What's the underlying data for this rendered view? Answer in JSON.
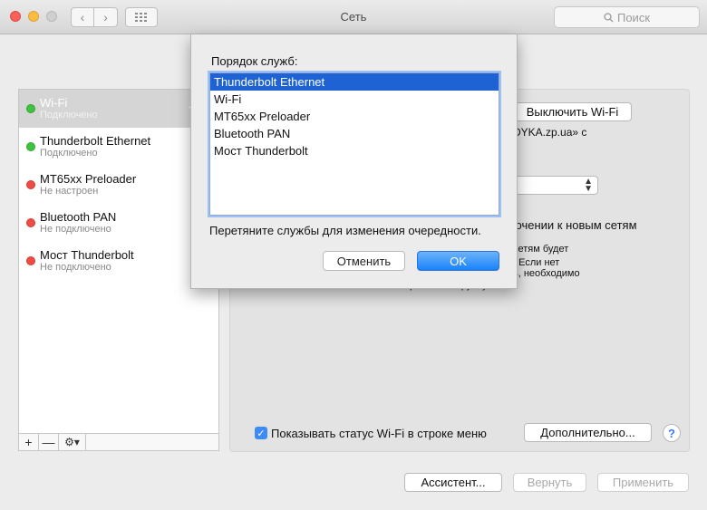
{
  "window": {
    "title": "Сеть"
  },
  "toolbar": {
    "search_placeholder": "Поиск",
    "back_glyph": "‹",
    "forward_glyph": "›"
  },
  "sidebar": {
    "items": [
      {
        "name": "Wi-Fi",
        "status": "Подключено",
        "status_color": "green",
        "selected": true,
        "icon": "wifi-icon"
      },
      {
        "name": "Thunderbolt Ethernet",
        "status": "Подключено",
        "status_color": "green",
        "icon": "ethernet-icon"
      },
      {
        "name": "MT65xx Preloader",
        "status": "Не настроен",
        "status_color": "red",
        "icon": "phone-icon"
      },
      {
        "name": "Bluetooth PAN",
        "status": "Не подключено",
        "status_color": "red",
        "icon": "bluetooth-icon"
      },
      {
        "name": "Мост Thunderbolt",
        "status": "Не подключено",
        "status_color": "red",
        "icon": "ethernet-icon"
      }
    ],
    "tools": {
      "add": "+",
      "remove": "—",
      "gear": "⚙▾"
    }
  },
  "main": {
    "wifi_off_button": "Выключить Wi-Fi",
    "network_text": "DYKA.zp.ua» с",
    "ask_join_text": "ючении к новым сетям",
    "desc_line1": "сетям будет",
    "desc_line2": ". Если нет",
    "desc_line3": "ь, необходимо",
    "desc_line4": "выбрать сеть вручную.",
    "show_status_label": "Показывать статус Wi-Fi в строке меню",
    "advanced_button": "Дополнительно...",
    "help": "?"
  },
  "footer": {
    "assistant": "Ассистент...",
    "revert": "Вернуть",
    "apply": "Применить"
  },
  "sheet": {
    "title": "Порядок служб:",
    "services": [
      "Thunderbolt Ethernet",
      "Wi-Fi",
      "MT65xx Preloader",
      "Bluetooth PAN",
      "Мост Thunderbolt"
    ],
    "hint": "Перетяните службы для изменения очередности.",
    "cancel": "Отменить",
    "ok": "OK"
  },
  "colors": {
    "accent": "#1e62d3",
    "green": "#3ec33e",
    "red": "#ef4b45"
  }
}
